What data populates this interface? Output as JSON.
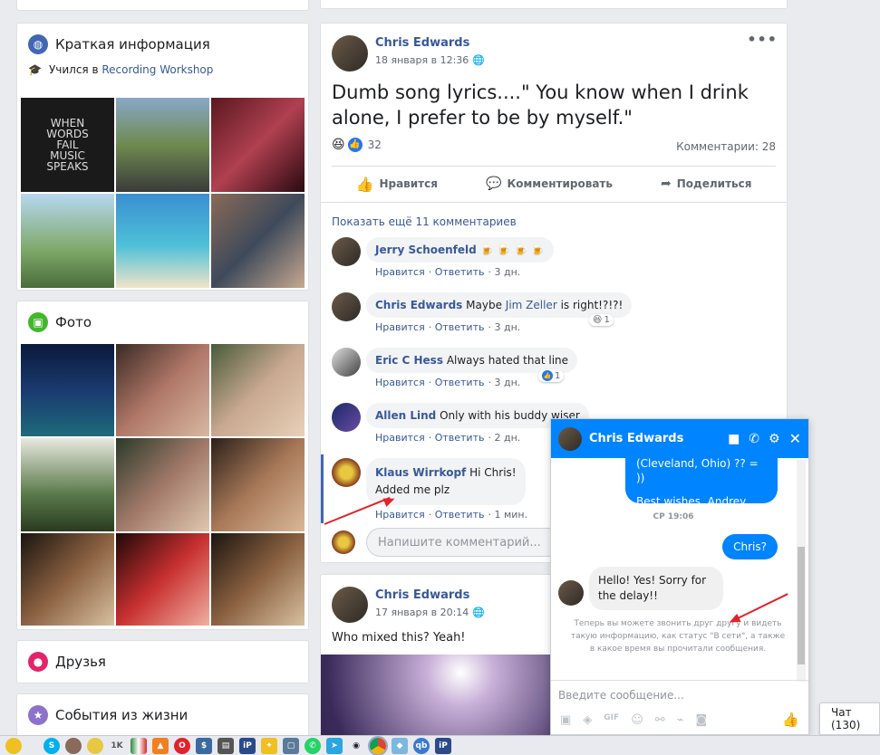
{
  "intro": {
    "title": "Краткая информация",
    "studied_prefix": "Учился в",
    "studied_link": "Recording Workshop",
    "tile_text": "WHEN WORDS FAIL MUSIC SPEAKS"
  },
  "photos": {
    "title": "Фото"
  },
  "friends": {
    "title": "Друзья"
  },
  "events": {
    "title": "События из жизни"
  },
  "post1": {
    "author": "Chris Edwards",
    "time": "18 января в 12:36",
    "text": "Dumb song lyrics....\" You know when I drink alone, I prefer to be by myself.\"",
    "reactions": "32",
    "comments_count": "Комментарии: 28",
    "like": "Нравится",
    "comment": "Комментировать",
    "share": "Поделиться",
    "show_more": "Показать ещё 11 комментариев",
    "input_placeholder": "Напишите комментарий..."
  },
  "comments": [
    {
      "name": "Jerry Schoenfeld",
      "text": "🍺 🍺 🍺 🍺",
      "like": "Нравится",
      "reply": "Ответить",
      "time": "3 дн.",
      "reaction": ""
    },
    {
      "name": "Chris Edwards",
      "text": "Maybe ",
      "mention": "Jim Zeller",
      "text2": " is right!?!?!",
      "like": "Нравится",
      "reply": "Ответить",
      "time": "3 дн.",
      "reaction": "1"
    },
    {
      "name": "Eric C Hess",
      "text": "Always hated that line",
      "like": "Нравится",
      "reply": "Ответить",
      "time": "3 дн.",
      "reaction": "1"
    },
    {
      "name": "Allen Lind",
      "text": "Only with his buddy wiser",
      "like": "Нравится",
      "reply": "Ответить",
      "time": "2 дн.",
      "reaction": ""
    },
    {
      "name": "Klaus Wirrkopf",
      "text": "Hi Chris!",
      "text2": "Added me plz",
      "like": "Нравится",
      "reply": "Ответить",
      "time": "1 мин.",
      "reaction": ""
    }
  ],
  "post2": {
    "author": "Chris Edwards",
    "time": "17 января в 20:14",
    "text": "Who mixed this? Yeah!"
  },
  "chat": {
    "name": "Chris Edwards",
    "msg_out1_a": "(Cleveland, Ohio) ?? = ))",
    "msg_out1_b": "Best wishes, Andrey",
    "timestamp": "СР 19:06",
    "msg_out2": "Chris?",
    "msg_in": "Hello!  Yes!  Sorry for the delay!!",
    "notice": "Теперь вы можете звонить друг другу и видеть такую информацию, как статус \"В сети\", а также в какое время вы прочитали сообщения.",
    "input_placeholder": "Введите сообщение..."
  },
  "chat_tab": {
    "label": "Чат (130)"
  },
  "colors": {
    "fb_blue": "#385898",
    "messenger_blue": "#0084ff",
    "arrow": "#e0232a"
  },
  "taskbar_icons": [
    "avast-icon",
    "skype-icon",
    "face-icon",
    "chick-icon",
    "1k-icon",
    "flag-icon",
    "vlc-icon",
    "opera-icon",
    "dollar-icon",
    "printer-icon",
    "ip-icon",
    "puzzle-icon",
    "box-icon",
    "whatsapp-icon",
    "telegram-icon",
    "eye-icon",
    "chrome-icon",
    "app-icon",
    "qb-icon",
    "ip2-icon"
  ]
}
